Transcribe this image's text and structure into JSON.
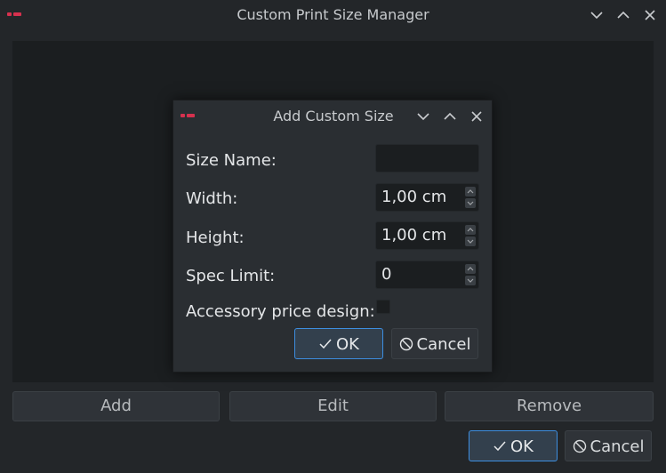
{
  "main_window": {
    "title": "Custom Print Size Manager",
    "buttons": {
      "add": "Add",
      "edit": "Edit",
      "remove": "Remove",
      "ok": "OK",
      "cancel": "Cancel"
    }
  },
  "dialog": {
    "title": "Add Custom Size",
    "fields": {
      "size_name": {
        "label": "Size Name:",
        "value": ""
      },
      "width": {
        "label": "Width:",
        "value": "1,00 cm"
      },
      "height": {
        "label": "Height:",
        "value": "1,00 cm"
      },
      "spec_limit": {
        "label": "Spec Limit:",
        "value": "0"
      },
      "accessory_price_design": {
        "label": "Accessory price design:",
        "checked": false
      }
    },
    "buttons": {
      "ok": "OK",
      "cancel": "Cancel"
    }
  },
  "icons": {
    "app": "app-logo-icon",
    "minimize": "chevron-down-icon",
    "maximize": "chevron-up-icon",
    "close": "close-icon",
    "ok": "checkmark-icon",
    "cancel": "cancel-circle-icon"
  },
  "colors": {
    "accent": "#3d8ee0",
    "app_icon": "#d6314e",
    "background": "#232629"
  }
}
